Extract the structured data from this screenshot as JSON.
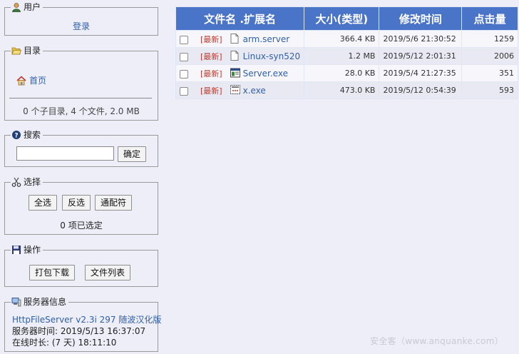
{
  "sidebar": {
    "user": {
      "title": "用户",
      "login_link": "登录"
    },
    "folder": {
      "title": "目录",
      "home_link": "首页",
      "summary": "0 个子目录, 4 个文件, 2.0 MB"
    },
    "search": {
      "title": "搜索",
      "input_value": "",
      "button_label": "确定"
    },
    "select": {
      "title": "选择",
      "buttons": [
        "全选",
        "反选",
        "通配符"
      ],
      "status": "0 项已选定"
    },
    "actions": {
      "title": "操作",
      "buttons": [
        "打包下载",
        "文件列表"
      ]
    },
    "server_info": {
      "title": "服务器信息",
      "version_link": "HttpFileServer v2.3i 297 随波汉化版",
      "server_time": "服务器时间: 2019/5/13 16:37:07",
      "uptime": "在线时长: (7 天) 18:11:10"
    }
  },
  "file_table": {
    "headers": [
      "文件名 .扩展名",
      "大小(类型)",
      "修改时间",
      "点击量"
    ],
    "rows": [
      {
        "tag": "[最新]",
        "icon": "file-icon",
        "name": "arm.server",
        "size": "366.4 KB",
        "modified": "2019/5/6 21:30:52",
        "hits": "1259"
      },
      {
        "tag": "[最新]",
        "icon": "file-icon",
        "name": "Linux-syn520",
        "size": "1.2 MB",
        "modified": "2019/5/12 2:01:31",
        "hits": "2006"
      },
      {
        "tag": "[最新]",
        "icon": "window-app-icon",
        "name": "Server.exe",
        "size": "28.0 KB",
        "modified": "2019/5/4 21:27:35",
        "hits": "351"
      },
      {
        "tag": "[最新]",
        "icon": "exe-dashed-icon",
        "name": "x.exe",
        "size": "473.0 KB",
        "modified": "2019/5/12 0:54:39",
        "hits": "593"
      }
    ]
  },
  "watermark": "安全客（www.anquanke.com）",
  "colors": {
    "page_bg": "#eeeef9",
    "header_bg": "#4a74c8",
    "link": "#3060a8",
    "new_tag": "#c0392b"
  }
}
